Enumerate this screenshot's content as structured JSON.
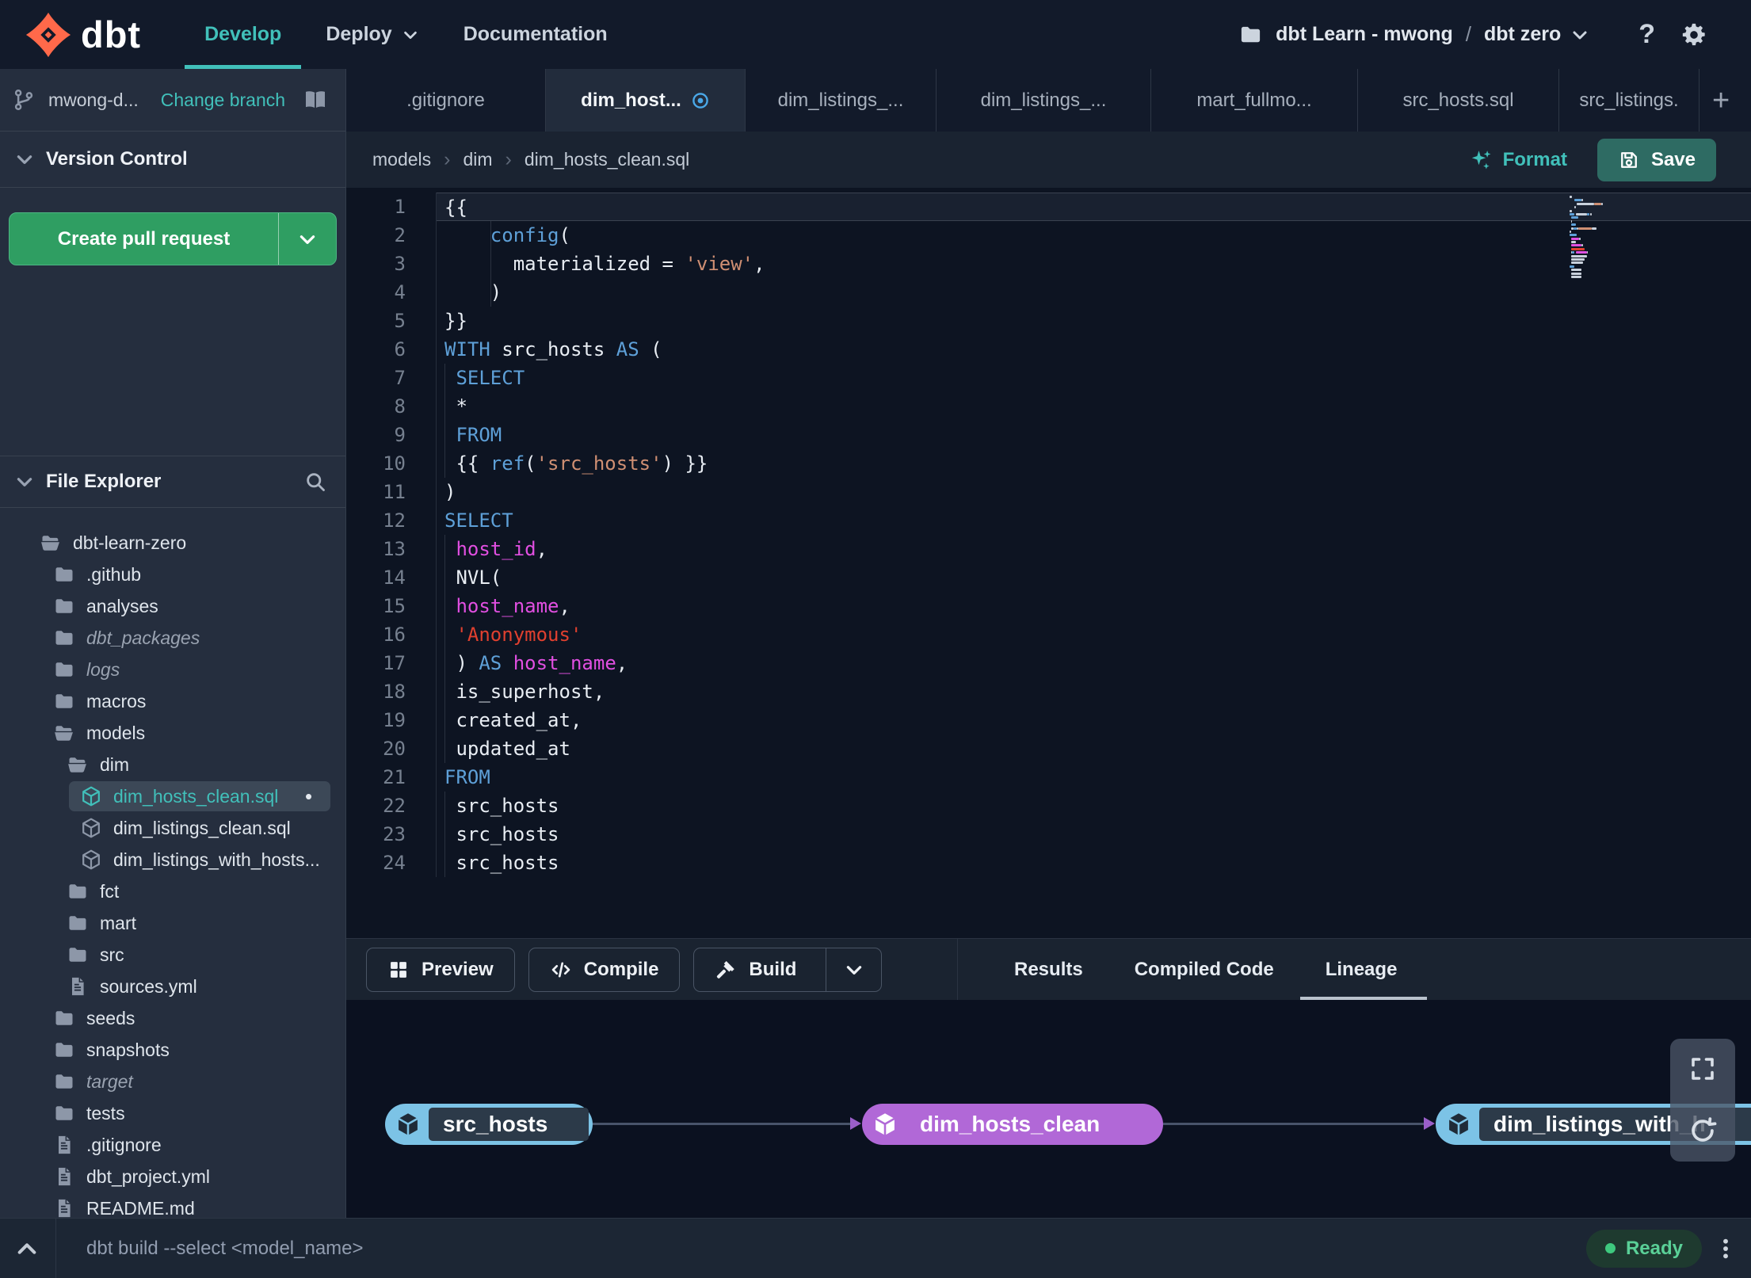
{
  "colors": {
    "accent_teal": "#41c0ba",
    "green_button": "#2f9e62",
    "save_button": "#2e6b63",
    "tab_active_indicator": "#4aa8e8",
    "lineage_source_node": "#7cc3e6",
    "lineage_model_node": "#b168d7",
    "edge_arrow": "#9a5fc9",
    "status_ready": "#3ec97e",
    "logo_orange": "#ff694a",
    "syntax_keyword": "#5ea0d8",
    "syntax_string": "#cf8f73",
    "syntax_string_red": "#e0402f",
    "syntax_identifier": "#e14fe1"
  },
  "glyphs": {
    "plus": "+",
    "help": "?",
    "breadcrumb_separator": "›",
    "project_separator": "/",
    "modified_dot": "•"
  },
  "nav": {
    "logo_text": "dbt",
    "links": [
      {
        "label": "Develop",
        "active": true
      },
      {
        "label": "Deploy",
        "dropdown": true
      },
      {
        "label": "Documentation"
      }
    ],
    "project": "dbt Learn - mwong",
    "environment": "dbt zero"
  },
  "sidebar": {
    "branch": {
      "name": "mwong-d...",
      "change_label": "Change branch"
    },
    "version_control": {
      "title": "Version Control",
      "create_pr_label": "Create pull request"
    },
    "file_explorer": {
      "title": "File Explorer",
      "tree": [
        {
          "name": "dbt-learn-zero",
          "icon": "folder-open",
          "level": 0
        },
        {
          "name": ".github",
          "icon": "folder",
          "level": 1
        },
        {
          "name": "analyses",
          "icon": "folder",
          "level": 1
        },
        {
          "name": "dbt_packages",
          "icon": "folder",
          "level": 1,
          "italic": true
        },
        {
          "name": "logs",
          "icon": "folder",
          "level": 1,
          "italic": true
        },
        {
          "name": "macros",
          "icon": "folder",
          "level": 1
        },
        {
          "name": "models",
          "icon": "folder-open",
          "level": 1
        },
        {
          "name": "dim",
          "icon": "folder-open",
          "level": 2
        },
        {
          "name": "dim_hosts_clean.sql",
          "icon": "model",
          "level": 3,
          "selected": true,
          "modified": true
        },
        {
          "name": "dim_listings_clean.sql",
          "icon": "model",
          "level": 3
        },
        {
          "name": "dim_listings_with_hosts...",
          "icon": "model",
          "level": 3
        },
        {
          "name": "fct",
          "icon": "folder",
          "level": 2
        },
        {
          "name": "mart",
          "icon": "folder",
          "level": 2
        },
        {
          "name": "src",
          "icon": "folder",
          "level": 2
        },
        {
          "name": "sources.yml",
          "icon": "file",
          "level": 2
        },
        {
          "name": "seeds",
          "icon": "folder",
          "level": 1
        },
        {
          "name": "snapshots",
          "icon": "folder",
          "level": 1
        },
        {
          "name": "target",
          "icon": "folder",
          "level": 1,
          "italic": true
        },
        {
          "name": "tests",
          "icon": "folder",
          "level": 1
        },
        {
          "name": ".gitignore",
          "icon": "file",
          "level": 1
        },
        {
          "name": "dbt_project.yml",
          "icon": "file",
          "level": 1
        },
        {
          "name": "README.md",
          "icon": "file",
          "level": 1
        }
      ]
    }
  },
  "tabs": [
    {
      "label": ".gitignore"
    },
    {
      "label": "dim_host...",
      "active": true,
      "modified": true
    },
    {
      "label": "dim_listings_..."
    },
    {
      "label": "dim_listings_..."
    },
    {
      "label": "mart_fullmo..."
    },
    {
      "label": "src_hosts.sql"
    },
    {
      "label": "src_listings."
    }
  ],
  "editor": {
    "breadcrumb": [
      "models",
      "dim",
      "dim_hosts_clean.sql"
    ],
    "format_label": "Format",
    "save_label": "Save",
    "active_line": 1,
    "lines": [
      {
        "tokens": [
          {
            "t": "{{",
            "c": "pl"
          }
        ]
      },
      {
        "tokens": [
          {
            "t": "    ",
            "c": "pl"
          },
          {
            "t": "config",
            "c": "kw"
          },
          {
            "t": "(",
            "c": "pl"
          }
        ]
      },
      {
        "tokens": [
          {
            "t": "      materialized = ",
            "c": "pl"
          },
          {
            "t": "'view'",
            "c": "str"
          },
          {
            "t": ",",
            "c": "pl"
          }
        ]
      },
      {
        "tokens": [
          {
            "t": "    )",
            "c": "pl"
          }
        ]
      },
      {
        "tokens": [
          {
            "t": "}}",
            "c": "pl"
          }
        ]
      },
      {
        "tokens": [
          {
            "t": "WITH",
            "c": "kw"
          },
          {
            "t": " src_hosts ",
            "c": "pl"
          },
          {
            "t": "AS",
            "c": "kw"
          },
          {
            "t": " (",
            "c": "pl"
          }
        ]
      },
      {
        "tokens": [
          {
            "t": " ",
            "c": "pl"
          },
          {
            "t": "SELECT",
            "c": "kw"
          }
        ]
      },
      {
        "tokens": [
          {
            "t": " *",
            "c": "pl"
          }
        ]
      },
      {
        "tokens": [
          {
            "t": " ",
            "c": "pl"
          },
          {
            "t": "FROM",
            "c": "kw"
          }
        ]
      },
      {
        "tokens": [
          {
            "t": " {{ ",
            "c": "pl"
          },
          {
            "t": "ref",
            "c": "kw"
          },
          {
            "t": "(",
            "c": "pl"
          },
          {
            "t": "'src_hosts'",
            "c": "str"
          },
          {
            "t": ") }}",
            "c": "pl"
          }
        ]
      },
      {
        "tokens": [
          {
            "t": ")",
            "c": "pl"
          }
        ]
      },
      {
        "tokens": [
          {
            "t": "SELECT",
            "c": "kw"
          }
        ]
      },
      {
        "tokens": [
          {
            "t": " ",
            "c": "pl"
          },
          {
            "t": "host_id",
            "c": "var"
          },
          {
            "t": ",",
            "c": "pl"
          }
        ]
      },
      {
        "tokens": [
          {
            "t": " NVL(",
            "c": "pl"
          }
        ]
      },
      {
        "tokens": [
          {
            "t": " ",
            "c": "pl"
          },
          {
            "t": "host_name",
            "c": "var"
          },
          {
            "t": ",",
            "c": "pl"
          }
        ]
      },
      {
        "tokens": [
          {
            "t": " ",
            "c": "pl"
          },
          {
            "t": "'Anonymous'",
            "c": "red"
          }
        ]
      },
      {
        "tokens": [
          {
            "t": " ) ",
            "c": "pl"
          },
          {
            "t": "AS",
            "c": "kw"
          },
          {
            "t": " ",
            "c": "pl"
          },
          {
            "t": "host_name",
            "c": "var"
          },
          {
            "t": ",",
            "c": "pl"
          }
        ]
      },
      {
        "tokens": [
          {
            "t": " is_superhost,",
            "c": "pl"
          }
        ]
      },
      {
        "tokens": [
          {
            "t": " created_at,",
            "c": "pl"
          }
        ]
      },
      {
        "tokens": [
          {
            "t": " updated_at",
            "c": "pl"
          }
        ]
      },
      {
        "tokens": [
          {
            "t": "FROM",
            "c": "kw"
          }
        ]
      },
      {
        "tokens": [
          {
            "t": " src_hosts",
            "c": "pl"
          }
        ]
      },
      {
        "tokens": [
          {
            "t": " src_hosts",
            "c": "pl"
          }
        ]
      },
      {
        "tokens": [
          {
            "t": " src_hosts",
            "c": "pl"
          }
        ]
      }
    ]
  },
  "panel": {
    "buttons": [
      {
        "label": "Preview",
        "icon": "grid"
      },
      {
        "label": "Compile",
        "icon": "codetag"
      },
      {
        "label": "Build",
        "icon": "hammer",
        "split": true
      }
    ],
    "tabs": [
      {
        "label": "Results"
      },
      {
        "label": "Compiled Code"
      },
      {
        "label": "Lineage",
        "active": true
      }
    ]
  },
  "lineage": {
    "nodes": [
      {
        "label": "src_hosts",
        "style": "source"
      },
      {
        "label": "dim_hosts_clean",
        "style": "model"
      },
      {
        "label": "dim_listings_with_h",
        "style": "source"
      }
    ]
  },
  "status": {
    "command": "dbt build --select <model_name>",
    "ready_label": "Ready"
  }
}
